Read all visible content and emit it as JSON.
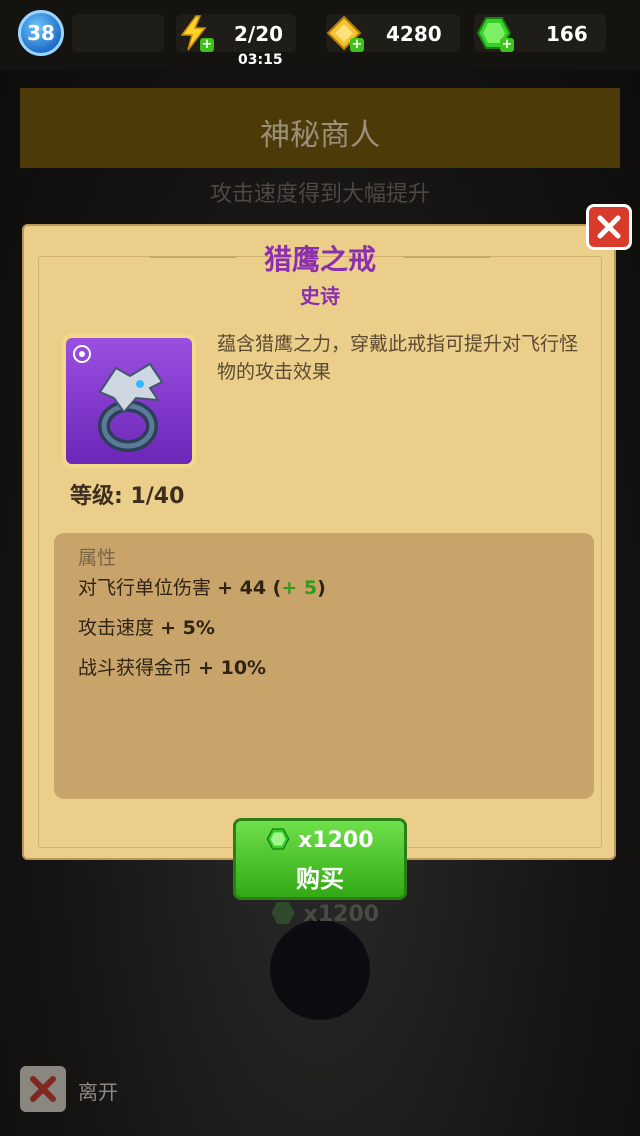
{
  "hud": {
    "player_level": "38",
    "energy": "2/20",
    "energy_timer": "03:15",
    "gold": "4280",
    "gems": "166"
  },
  "background": {
    "shop_title": "神秘商人",
    "subtitle": "攻击速度得到大幅提升"
  },
  "item": {
    "name": "猎鹰之戒",
    "rarity": "史诗",
    "description": "蕴含猎鹰之力，穿戴此戒指可提升对飞行怪物的攻击效果",
    "level": "等级: 1/40",
    "attributes_header": "属性",
    "attributes": [
      {
        "label": "对飞行单位伤害",
        "value": "+ 44 (",
        "bonus": "+ 5",
        "suffix": ")"
      },
      {
        "label": "攻击速度",
        "value": "+ 5%"
      },
      {
        "label": "战斗获得金币",
        "value": "+ 10%"
      }
    ]
  },
  "buy_button": {
    "price": "x1200",
    "label": "购买"
  },
  "background_price": "x1200",
  "leave_label": "离开",
  "colors": {
    "rarity_purple": "#8b2fb0",
    "buy_green": "#3fc11b",
    "close_red": "#d83b2c"
  },
  "icons": [
    "lightning-icon",
    "gold-icon",
    "gem-icon",
    "ring-icon",
    "close-icon"
  ]
}
